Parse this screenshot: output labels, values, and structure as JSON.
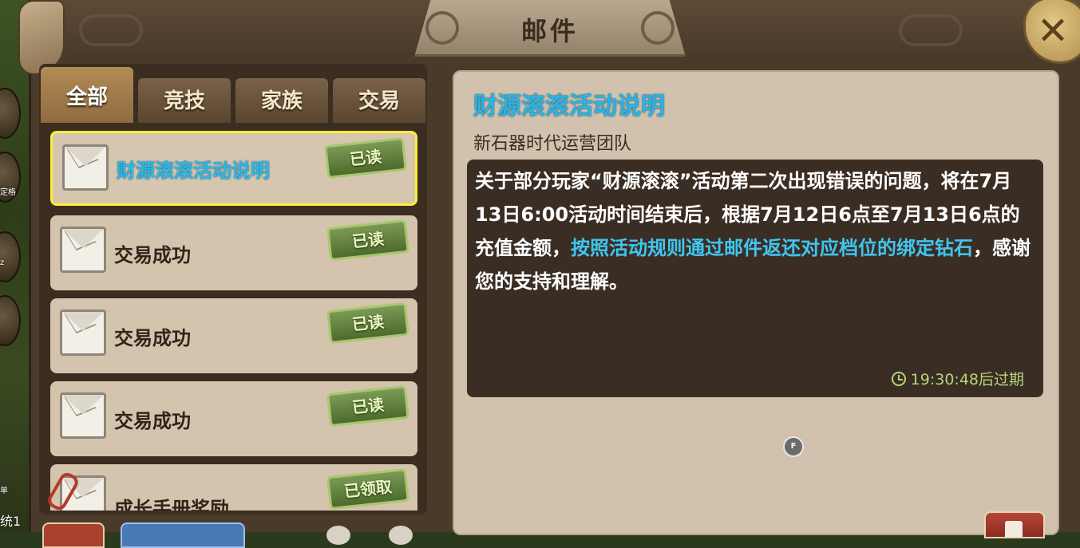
{
  "window": {
    "title": "邮件"
  },
  "tabs": [
    {
      "label": "全部",
      "active": true
    },
    {
      "label": "竞技",
      "active": false
    },
    {
      "label": "家族",
      "active": false
    },
    {
      "label": "交易",
      "active": false
    }
  ],
  "side_labels": [
    "定格",
    "z",
    "单",
    "统1"
  ],
  "mails": [
    {
      "subject": "财源滚滚活动说明",
      "status": "已读",
      "selected": true,
      "attachment": false
    },
    {
      "subject": "交易成功",
      "status": "已读",
      "selected": false,
      "attachment": false
    },
    {
      "subject": "交易成功",
      "status": "已读",
      "selected": false,
      "attachment": false
    },
    {
      "subject": "交易成功",
      "status": "已读",
      "selected": false,
      "attachment": false
    },
    {
      "subject": "成长手册奖励",
      "status": "已领取",
      "selected": false,
      "attachment": true
    }
  ],
  "detail": {
    "title": "财源滚滚活动说明",
    "sender": "新石器时代运营团队",
    "body_plain": "关于部分玩家“财源滚滚”活动第二次出现错误的问题，将在7月13日6:00活动时间结束后，根据7月12日6点至7月13日6点的充值金额，",
    "body_highlight": "按照活动规则通过邮件返还对应档位的绑定钻石",
    "body_end": "，感谢您的支持和理解。",
    "expire": "19:30:48后过期",
    "marker": "F"
  },
  "colors": {
    "highlight": "#3fc6f2",
    "title_blue": "#29b4e6",
    "selected_border": "#ffee33",
    "badge_green": "#5f7f3a",
    "expire_green": "#b7d37a"
  },
  "icons": {
    "close": "close-icon",
    "mail": "envelope-icon",
    "attachment": "paperclip-icon",
    "clock": "clock-icon",
    "delete": "trash-icon"
  }
}
